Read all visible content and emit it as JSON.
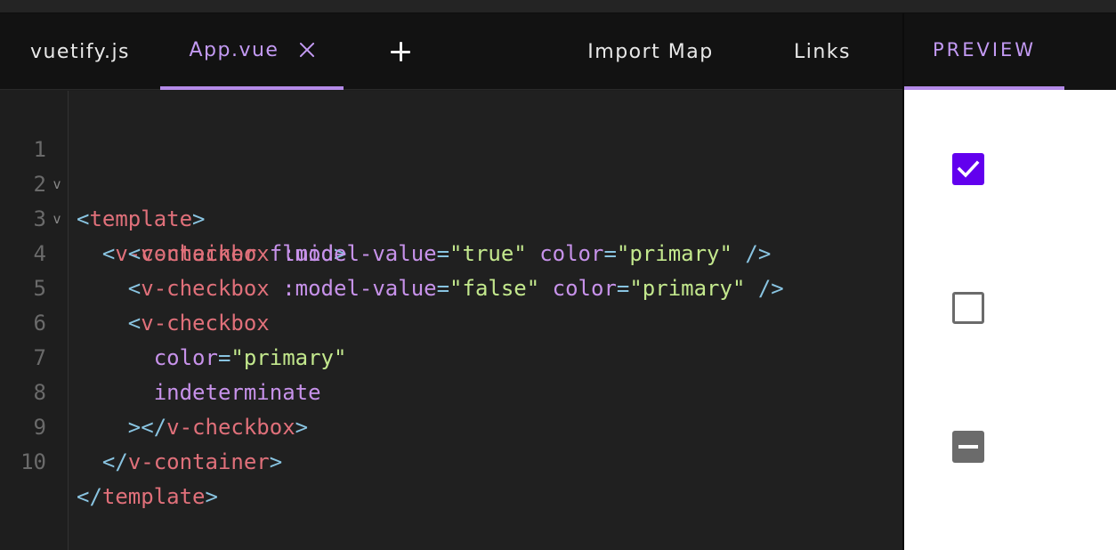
{
  "editor": {
    "tabs": [
      {
        "label": "vuetify.js"
      },
      {
        "label": "App.vue"
      }
    ],
    "add_tab_symbol": "+",
    "right_tabs": [
      {
        "label": "Import Map"
      },
      {
        "label": "Links"
      }
    ],
    "line_numbers": [
      "1",
      "2",
      "3",
      "4",
      "5",
      "6",
      "7",
      "8",
      "9",
      "10"
    ],
    "fold_marker": "v"
  },
  "code": {
    "l1": {
      "lt": "<",
      "tag": "template",
      "gt": ">"
    },
    "l2": {
      "lt": "<",
      "tag": "v-container",
      "attr": "fluid",
      "gt": ">"
    },
    "l3": {
      "lt": "<",
      "tag": "v-checkbox",
      "attr1": ":model-value",
      "eq1": "=",
      "val1": "\"true\"",
      "attr2": "color",
      "eq2": "=",
      "val2": "\"primary\"",
      "end": "/>"
    },
    "l4": {
      "lt": "<",
      "tag": "v-checkbox",
      "attr1": ":model-value",
      "eq1": "=",
      "val1": "\"false\"",
      "attr2": "color",
      "eq2": "=",
      "val2": "\"primary\"",
      "end": "/>"
    },
    "l5": {
      "lt": "<",
      "tag": "v-checkbox"
    },
    "l6": {
      "attr": "color",
      "eq": "=",
      "val": "\"primary\""
    },
    "l7": {
      "attr": "indeterminate"
    },
    "l8": {
      "gt": ">",
      "lt": "</",
      "tag": "v-checkbox",
      "gt2": ">"
    },
    "l9": {
      "lt": "</",
      "tag": "v-container",
      "gt": ">"
    },
    "l10": {
      "lt": "</",
      "tag": "template",
      "gt": ">"
    }
  },
  "preview": {
    "tab_label": "PREVIEW",
    "checkboxes": [
      {
        "state": "checked",
        "color": "#6200ee"
      },
      {
        "state": "unchecked"
      },
      {
        "state": "indeterminate"
      }
    ]
  }
}
